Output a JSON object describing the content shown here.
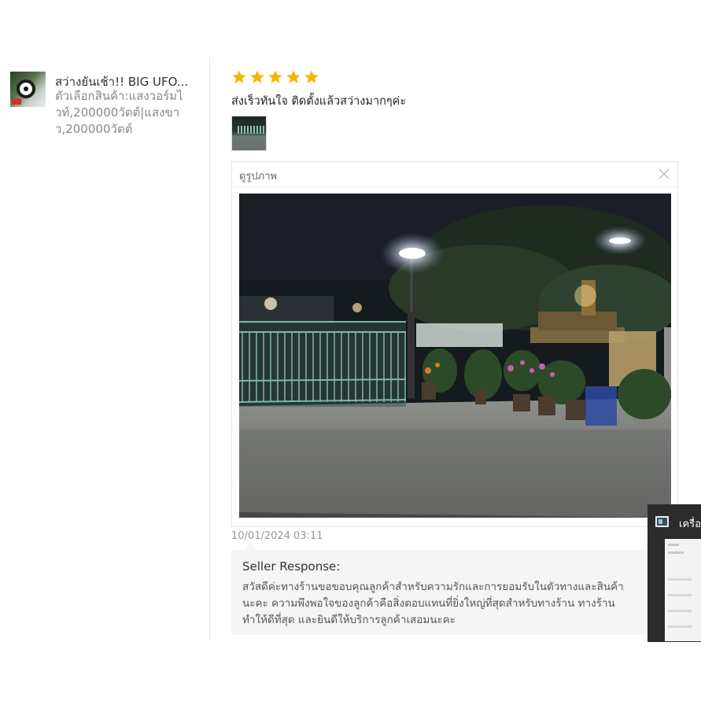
{
  "product": {
    "title": "สว่างยันเช้า!! BIG UFO...",
    "variant": "ตัวเลือกสินค้า:แสงวอร์มไวท์,200000วัตต์|แสงขาว,200000วัตต์"
  },
  "review": {
    "rating": 5,
    "text": "ส่งเร็วทันใจ ติดตั้งแล้วสว่างมากๆค่ะ",
    "date": "10/01/2024 03:11"
  },
  "viewer": {
    "title": "ดูรูปภาพ"
  },
  "seller": {
    "label": "Seller Response:",
    "text": "สวัสดีค่ะทางร้านขอขอบคุณลูกค้าสำหรับความรักและการยอมรับในตัวทางและสินค้า\nนะคะ ความพึงพอใจของลูกค้าคือสิ่งตอบแทนที่ยิ่งใหญ่ที่สุดสำหรับทางร้าน ทางร้าน\nทำให้ดีที่สุด และยินดีให้บริการลูกค้าเสอมนะคะ"
  },
  "overlay": {
    "title": "เครื่อง"
  },
  "colors": {
    "star": "#f5b400",
    "divider": "#e8e8e8",
    "seller_bg": "#f5f5f5"
  },
  "icons": [
    "star-icon",
    "close-icon",
    "calculator-app-icon"
  ]
}
